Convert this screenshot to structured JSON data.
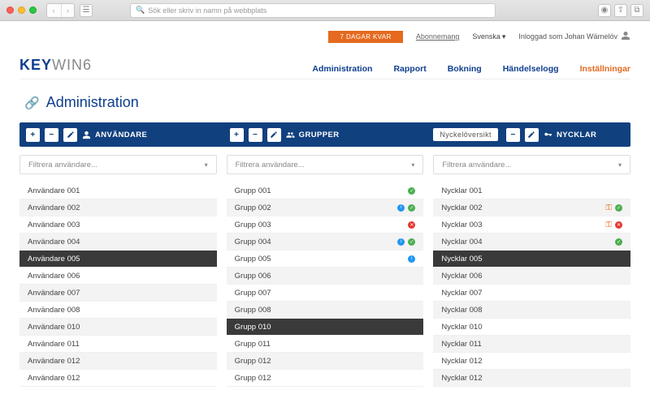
{
  "browser": {
    "url_placeholder": "Sök eller skriv in namn på webbplats"
  },
  "topbar": {
    "days_badge": "7 DAGAR KVAR",
    "subscription": "Abonnemang",
    "language": "Svenska",
    "logged_in": "Inloggad som Johan Wärnelöv"
  },
  "logo": {
    "part1": "KEY",
    "part2": "WIN6"
  },
  "nav": {
    "administration": "Administration",
    "rapport": "Rapport",
    "bokning": "Bokning",
    "handelselogg": "Händelselogg",
    "installningar": "Inställningar"
  },
  "page_title": "Administration",
  "cols": {
    "users": {
      "title": "ANVÄNDARE",
      "filter_placeholder": "Filtrera användare...",
      "items": [
        {
          "label": "Användare 001",
          "alt": false
        },
        {
          "label": "Användare 002",
          "alt": true
        },
        {
          "label": "Användare 003",
          "alt": false
        },
        {
          "label": "Användare 004",
          "alt": true
        },
        {
          "label": "Användare 005",
          "sel": true
        },
        {
          "label": "Användare 006",
          "alt": false
        },
        {
          "label": "Användare 007",
          "alt": true
        },
        {
          "label": "Användare 008",
          "alt": false
        },
        {
          "label": "Användare 010",
          "alt": true
        },
        {
          "label": "Användare 011",
          "alt": false
        },
        {
          "label": "Användare 012",
          "alt": true
        },
        {
          "label": "Användare 012",
          "alt": false
        }
      ]
    },
    "groups": {
      "title": "GRUPPER",
      "filter_placeholder": "Filtrera användare...",
      "items": [
        {
          "label": "Grupp 001",
          "alt": false,
          "icons": [
            "g"
          ]
        },
        {
          "label": "Grupp 002",
          "alt": true,
          "icons": [
            "b",
            "g"
          ]
        },
        {
          "label": "Grupp 003",
          "alt": false,
          "icons": [
            "r"
          ]
        },
        {
          "label": "Grupp 004",
          "alt": true,
          "icons": [
            "b",
            "g"
          ]
        },
        {
          "label": "Grupp 005",
          "alt": false,
          "icons": [
            "b"
          ]
        },
        {
          "label": "Grupp 006",
          "alt": true
        },
        {
          "label": "Grupp 007",
          "alt": false
        },
        {
          "label": "Grupp 008",
          "alt": true
        },
        {
          "label": "Grupp 010",
          "sel": true
        },
        {
          "label": "Grupp 011",
          "alt": false
        },
        {
          "label": "Grupp 012",
          "alt": true
        },
        {
          "label": "Grupp 012",
          "alt": false
        }
      ]
    },
    "keys": {
      "title": "NYCKLAR",
      "overview_btn": "Nyckelöversikt",
      "filter_placeholder": "Filtrera användare...",
      "items": [
        {
          "label": "Nycklar 001",
          "alt": false
        },
        {
          "label": "Nycklar 002",
          "alt": true,
          "icons": [
            "ko",
            "g"
          ]
        },
        {
          "label": "Nycklar 003",
          "alt": false,
          "icons": [
            "ko",
            "r"
          ]
        },
        {
          "label": "Nycklar 004",
          "alt": true,
          "icons": [
            "g"
          ]
        },
        {
          "label": "Nycklar 005",
          "sel": true
        },
        {
          "label": "Nycklar 006",
          "alt": true
        },
        {
          "label": "Nycklar 007",
          "alt": false
        },
        {
          "label": "Nycklar 008",
          "alt": true
        },
        {
          "label": "Nycklar 010",
          "alt": false
        },
        {
          "label": "Nycklar 011",
          "alt": true
        },
        {
          "label": "Nycklar 012",
          "alt": false
        },
        {
          "label": "Nycklar 012",
          "alt": true
        }
      ]
    }
  }
}
